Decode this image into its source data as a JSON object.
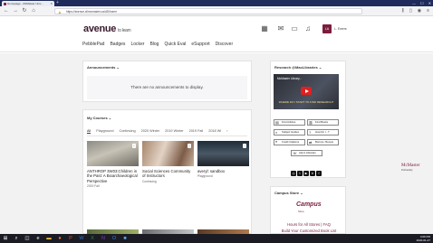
{
  "browser": {
    "tab_title": "Homepage - McMaster Univ...",
    "url": "https://avenue.cllmcmaster.ca/d2l/home",
    "min": "—",
    "max": "☐",
    "close": "✕"
  },
  "header": {
    "logo": "avenue",
    "logo_sub": "to learn",
    "avatar_initials": "LA",
    "username": "L. Ewers"
  },
  "nav": [
    "PebblePad",
    "Badges",
    "Locker",
    "Blog",
    "Quick Eval",
    "eSupport",
    "Discover"
  ],
  "announcements": {
    "title": "Announcements",
    "empty_text": "There are no announcements to display."
  },
  "courses": {
    "title": "My Courses",
    "tabs": [
      "All",
      "Playground",
      "Continuing",
      "2020 Winter",
      "2019 Winter",
      "2019 Fall",
      "2018 Wi"
    ],
    "cards": [
      {
        "title": "ANTHROP 3W03:Children in the Past: A Bioarchaeological Perspective",
        "meta": "2019 Fall"
      },
      {
        "title": "Social Sciences Community of Instructors",
        "meta": "Continuing"
      },
      {
        "title": "averyl: sandbox",
        "meta": "Playground"
      }
    ]
  },
  "research": {
    "title": "Research @MacLibraries",
    "video_title": "McMaster Library...",
    "video_caption": "WHERE DO I START TO FIND RESEARCH?",
    "buttons": [
      "Find Articles",
      "Find Books",
      "Subject Guides",
      "How Do I...?",
      "Credit Citations",
      "Borrow / Renew",
      "Ask A Librarian"
    ]
  },
  "store": {
    "title": "Campus Store",
    "logo": "Campus",
    "logo_sub": "Store",
    "link1": "Hours for All Stores | FAQ",
    "link2": "Build Your Customized Book List"
  },
  "mcmaster": {
    "name": "McMaster",
    "sub": "University"
  },
  "clock": {
    "time": "4:06 PM",
    "date": "2020-01-27"
  },
  "colors": {
    "brand": "#7b1d3f",
    "titlebar": "#1f2b5b",
    "page_bg": "#f2f2f2"
  }
}
